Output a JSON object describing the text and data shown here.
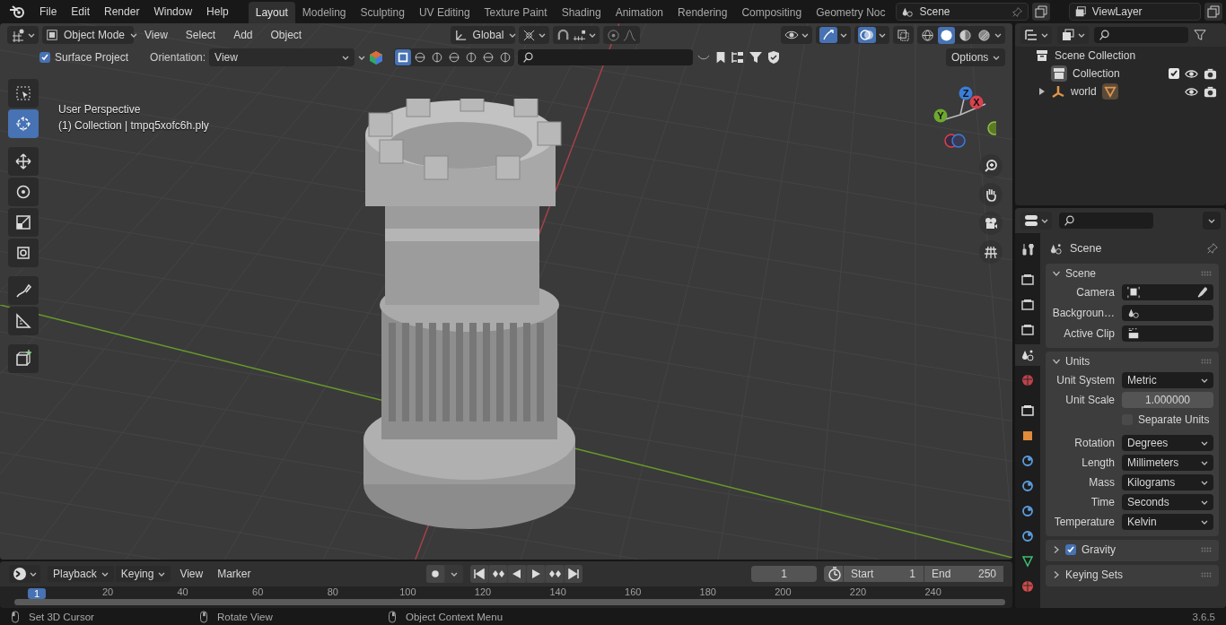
{
  "top_bar": {
    "menus": [
      "File",
      "Edit",
      "Render",
      "Window",
      "Help"
    ],
    "workspace_tabs": [
      {
        "label": "Layout",
        "selected": true
      },
      {
        "label": "Modeling",
        "selected": false
      },
      {
        "label": "Sculpting",
        "selected": false
      },
      {
        "label": "UV Editing",
        "selected": false
      },
      {
        "label": "Texture Paint",
        "selected": false
      },
      {
        "label": "Shading",
        "selected": false
      },
      {
        "label": "Animation",
        "selected": false
      },
      {
        "label": "Rendering",
        "selected": false
      },
      {
        "label": "Compositing",
        "selected": false
      },
      {
        "label": "Geometry Noc",
        "selected": false
      }
    ],
    "scene": "Scene",
    "view_layer": "ViewLayer"
  },
  "viewport": {
    "mode": "Object Mode",
    "menus": [
      "View",
      "Select",
      "Add",
      "Object"
    ],
    "orientation": "Global",
    "shading_modes": [
      {
        "kind": "wireframe",
        "selected": false
      },
      {
        "kind": "solid",
        "selected": true
      },
      {
        "kind": "material",
        "selected": false
      },
      {
        "kind": "rendered",
        "selected": false
      }
    ],
    "surface_project": {
      "label": "Surface Project",
      "checked": true
    },
    "orientation_label": "Orientation:",
    "orientation_value": "View",
    "options": "Options",
    "info": [
      "User Perspective",
      "(1) Collection | tmpq5xofc6h.ply"
    ],
    "tools": [
      {
        "kind": "select",
        "selected": false
      },
      {
        "kind": "cursor",
        "selected": true
      },
      {
        "kind": "move",
        "selected": false
      },
      {
        "kind": "rotate",
        "selected": false
      },
      {
        "kind": "scale",
        "selected": false
      },
      {
        "kind": "transform",
        "selected": false
      },
      {
        "kind": "annotate",
        "selected": false
      },
      {
        "kind": "measure",
        "selected": false
      },
      {
        "kind": "add-cube",
        "selected": false
      }
    ],
    "axes": [
      "X",
      "Y",
      "Z"
    ]
  },
  "outliner": {
    "tree": [
      {
        "label": "Scene Collection",
        "children": [
          {
            "label": "Collection",
            "checked": true
          },
          {
            "label": "world",
            "expanded": false
          }
        ]
      }
    ]
  },
  "properties": {
    "tabs": [
      {
        "kind": "tool",
        "selected": false
      },
      {
        "kind": "render",
        "selected": false
      },
      {
        "kind": "output",
        "selected": false
      },
      {
        "kind": "view-layer",
        "selected": false
      },
      {
        "kind": "scene",
        "selected": true
      },
      {
        "kind": "world",
        "selected": false
      },
      {
        "kind": "collection",
        "selected": false
      },
      {
        "kind": "object",
        "selected": false
      },
      {
        "kind": "modifier",
        "selected": false
      },
      {
        "kind": "particles",
        "selected": false
      },
      {
        "kind": "physics",
        "selected": false
      },
      {
        "kind": "constraint",
        "selected": false
      },
      {
        "kind": "data",
        "selected": false
      },
      {
        "kind": "material",
        "selected": false
      }
    ],
    "title": "Scene",
    "panels": [
      {
        "title": "Scene",
        "expanded": true,
        "rows": [
          {
            "label": "Camera",
            "kind": "picker"
          },
          {
            "label": "Backgroun…",
            "kind": "picker"
          },
          {
            "label": "Active Clip",
            "kind": "picker"
          }
        ]
      },
      {
        "title": "Units",
        "expanded": true,
        "rows": [
          {
            "label": "Unit System",
            "kind": "dropdown",
            "value": "Metric"
          },
          {
            "label": "Unit Scale",
            "kind": "number",
            "value": "1.000000"
          },
          {
            "label": "Separate Units",
            "kind": "checkbox",
            "checked": false
          },
          {
            "label": "Rotation",
            "kind": "dropdown",
            "value": "Degrees"
          },
          {
            "label": "Length",
            "kind": "dropdown",
            "value": "Millimeters"
          },
          {
            "label": "Mass",
            "kind": "dropdown",
            "value": "Kilograms"
          },
          {
            "label": "Time",
            "kind": "dropdown",
            "value": "Seconds"
          },
          {
            "label": "Temperature",
            "kind": "dropdown",
            "value": "Kelvin"
          }
        ]
      },
      {
        "title": "Gravity",
        "expanded": false,
        "checked": true
      },
      {
        "title": "Keying Sets",
        "expanded": false
      }
    ]
  },
  "timeline": {
    "menus": [
      {
        "label": "Playback",
        "kind": "dropdown"
      },
      {
        "label": "Keying",
        "kind": "dropdown"
      },
      {
        "label": "View",
        "kind": "plain"
      },
      {
        "label": "Marker",
        "kind": "plain"
      }
    ],
    "current_frame": "1",
    "start_label": "Start",
    "start": "1",
    "end_label": "End",
    "end": "250",
    "frame_marker": "1",
    "ruler": [
      "20",
      "40",
      "60",
      "80",
      "100",
      "120",
      "140",
      "160",
      "180",
      "200",
      "220",
      "240"
    ]
  },
  "status_bar": {
    "hints": [
      "Set 3D Cursor",
      "Rotate View",
      "Object Context Menu"
    ],
    "version": "3.6.5"
  }
}
